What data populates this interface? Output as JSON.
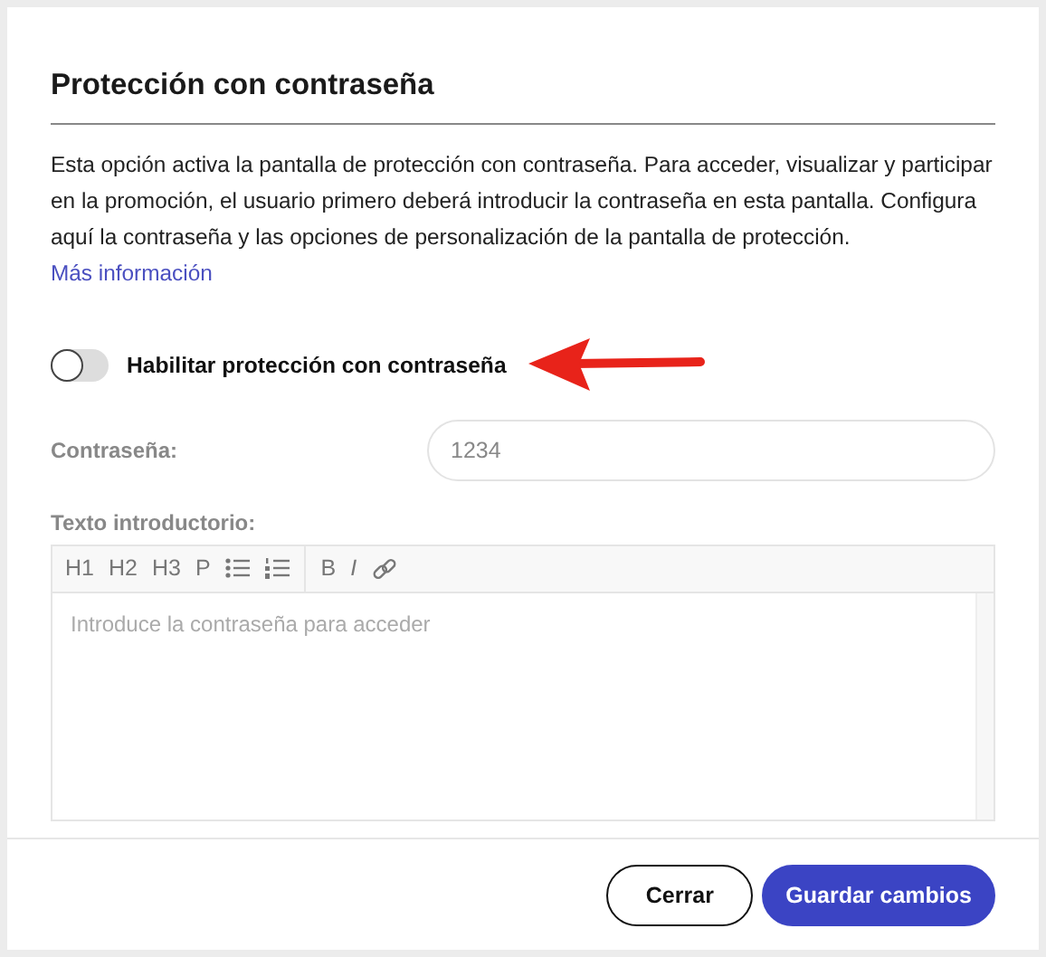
{
  "modal": {
    "title": "Protección con contraseña",
    "description": "Esta opción activa la pantalla de protección con contraseña. Para acceder, visualizar y participar en la promoción, el usuario primero deberá introducir la contraseña en esta pantalla. Configura aquí la contraseña y las opciones de personalización de la pantalla de protección.",
    "more_link": "Más información",
    "toggle": {
      "label": "Habilitar protección con contraseña",
      "on": false
    },
    "password": {
      "label": "Contraseña:",
      "value": "1234",
      "disabled": true
    },
    "intro": {
      "label": "Texto introductorio:",
      "placeholder": "Introduce la contraseña para acceder",
      "disabled": true,
      "toolbar": [
        {
          "kind": "text",
          "label": "H1"
        },
        {
          "kind": "text",
          "label": "H2"
        },
        {
          "kind": "text",
          "label": "H3"
        },
        {
          "kind": "text",
          "label": "P"
        },
        {
          "kind": "bullet-list"
        },
        {
          "kind": "numbered-list"
        },
        {
          "kind": "separator"
        },
        {
          "kind": "text",
          "label": "B"
        },
        {
          "kind": "italic",
          "label": "I"
        },
        {
          "kind": "link"
        }
      ]
    },
    "buttons": [
      {
        "label": "Cerrar",
        "kind": "secondary"
      },
      {
        "label": "Guardar cambios",
        "kind": "primary"
      }
    ]
  }
}
